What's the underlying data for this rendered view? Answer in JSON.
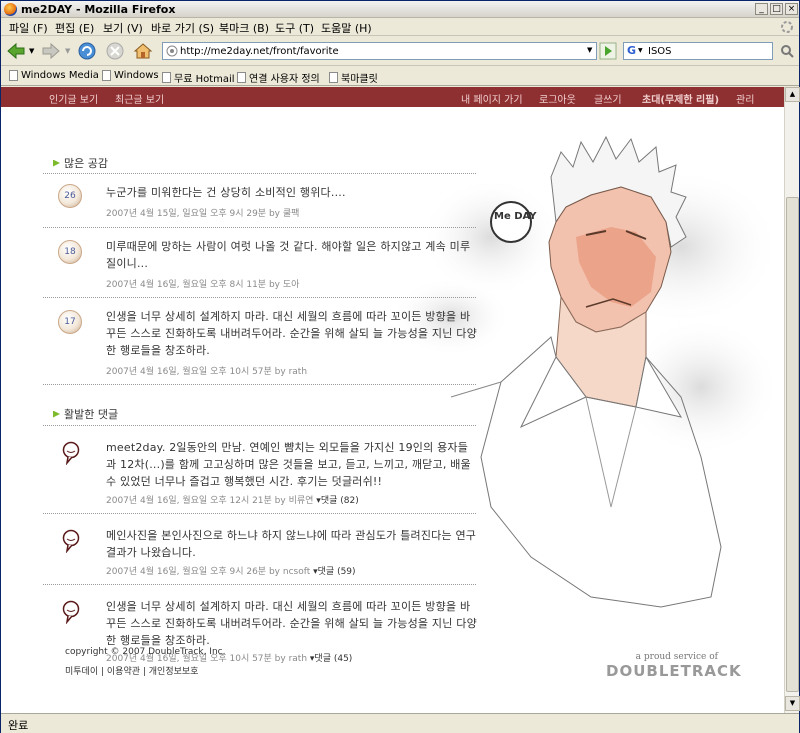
{
  "window": {
    "title": "me2DAY - Mozilla Firefox"
  },
  "menu": [
    "파일 (F)",
    "편집 (E)",
    "보기 (V)",
    "바로 가기 (S)",
    "북마크 (B)",
    "도구 (T)",
    "도움말 (H)"
  ],
  "toolbar": {
    "url": "http://me2day.net/front/favorite",
    "search_value": "ISOS"
  },
  "bookmarks": [
    "Windows Media",
    "Windows",
    "무료 Hotmail",
    "연결 사용자 정의",
    "북마클릿"
  ],
  "site_nav": {
    "left": [
      "인기글 보기",
      "최근글 보기"
    ],
    "right": [
      "내 페이지 가기",
      "로그아웃",
      "글쓰기",
      "초대(무제한 리필)",
      "관리"
    ]
  },
  "sections": {
    "popular": {
      "title": "많은 공감",
      "items": [
        {
          "count": "26",
          "text": "누군가를 미워한다는 건 상당히 소비적인 행위다....",
          "meta": "2007년 4월 15일, 일요일 오후 9시 29분 by ",
          "author": "쿨팩"
        },
        {
          "count": "18",
          "text": "미루때문에 망하는 사람이 여럿 나올 것 같다. 해야할 일은 하지않고 계속 미루질이니...",
          "meta": "2007년 4월 16일, 월요일 오후 8시 11분 by ",
          "author": "도아"
        },
        {
          "count": "17",
          "text": "인생을 너무 상세히 설계하지 마라. 대신 세월의 흐름에 따라 꼬이든 방향을 바꾸든 스스로 진화하도록 내버려두어라. 순간을 위해 살되 늘 가능성을 지닌 다양한 행로들을 창조하라.",
          "meta": "2007년 4월 16일, 월요일 오후 10시 57분 by ",
          "author": "rath"
        }
      ]
    },
    "active": {
      "title": "활발한 댓글",
      "items": [
        {
          "text": "meet2day. 2일동안의 만남. 연예인 뺨치는 외모들을 가지신 19인의 용자들과 12차(...)를 함께 고고싱하며 많은 것들을 보고, 듣고, 느끼고, 깨닫고, 배울 수 있었던 너무나 즐겁고 행복했던 시간. 후기는 덧글러쉬!!",
          "meta": "2007년 4월 16일, 월요일 오후 12시 21분 by ",
          "author": "비류연",
          "comments": "▾댓글 (82)"
        },
        {
          "text": "메인사진을 본인사진으로 하느냐 하지 않느냐에 따라 관심도가 틀려진다는 연구결과가 나왔습니다.",
          "meta": "2007년 4월 16일, 월요일 오후 9시 26분 by ",
          "author": "ncsoft",
          "comments": "▾댓글 (59)"
        },
        {
          "text": "인생을 너무 상세히 설계하지 마라. 대신 세월의 흐름에 따라 꼬이든 방향을 바꾸든 스스로 진화하도록 내버려두어라. 순간을 위해 살되 늘 가능성을 지닌 다양한 행로들을 창조하라.",
          "meta": "2007년 4월 16일, 월요일 오후 10시 57분 by ",
          "author": "rath",
          "comments": "▾댓글 (45)"
        }
      ]
    }
  },
  "footer": {
    "copyright": "copyright © 2007 DoubleTrack, Inc.",
    "links": [
      "미투데이",
      "이용약관",
      "개인정보보호"
    ],
    "brand_tag": "a proud service of",
    "brand": "DOUBLETRACK"
  },
  "illustration": {
    "logo_text": "Me DAY"
  },
  "status": {
    "text": "완료"
  }
}
